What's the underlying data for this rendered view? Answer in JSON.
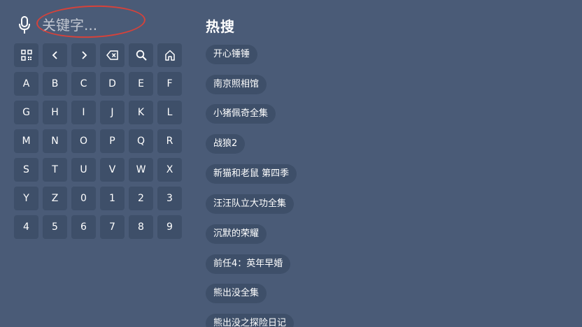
{
  "search": {
    "placeholder": "关键字..."
  },
  "keyboard": {
    "keys": [
      {
        "label": "",
        "icon": "qr-code-icon"
      },
      {
        "label": "",
        "icon": "chevron-left-icon"
      },
      {
        "label": "",
        "icon": "chevron-right-icon"
      },
      {
        "label": "",
        "icon": "backspace-icon"
      },
      {
        "label": "",
        "icon": "search-icon"
      },
      {
        "label": "",
        "icon": "home-icon"
      },
      {
        "label": "A"
      },
      {
        "label": "B"
      },
      {
        "label": "C"
      },
      {
        "label": "D"
      },
      {
        "label": "E"
      },
      {
        "label": "F"
      },
      {
        "label": "G"
      },
      {
        "label": "H"
      },
      {
        "label": "I"
      },
      {
        "label": "J"
      },
      {
        "label": "K"
      },
      {
        "label": "L"
      },
      {
        "label": "M"
      },
      {
        "label": "N"
      },
      {
        "label": "O"
      },
      {
        "label": "P"
      },
      {
        "label": "Q"
      },
      {
        "label": "R"
      },
      {
        "label": "S"
      },
      {
        "label": "T"
      },
      {
        "label": "U"
      },
      {
        "label": "V"
      },
      {
        "label": "W"
      },
      {
        "label": "X"
      },
      {
        "label": "Y"
      },
      {
        "label": "Z"
      },
      {
        "label": "0"
      },
      {
        "label": "1"
      },
      {
        "label": "2"
      },
      {
        "label": "3"
      },
      {
        "label": "4"
      },
      {
        "label": "5"
      },
      {
        "label": "6"
      },
      {
        "label": "7"
      },
      {
        "label": "8"
      },
      {
        "label": "9"
      }
    ]
  },
  "hot": {
    "title": "热搜",
    "items": [
      "开心锤锤",
      "南京照相馆",
      "小猪佩奇全集",
      "战狼2",
      "新猫和老鼠 第四季",
      "汪汪队立大功全集",
      "沉默的荣耀",
      "前任4：英年早婚",
      "熊出没全集",
      "熊出没之探险日记"
    ]
  },
  "colors": {
    "background": "#4a5b77",
    "key_background": "#3e4f69",
    "annotation": "#d6423a"
  }
}
